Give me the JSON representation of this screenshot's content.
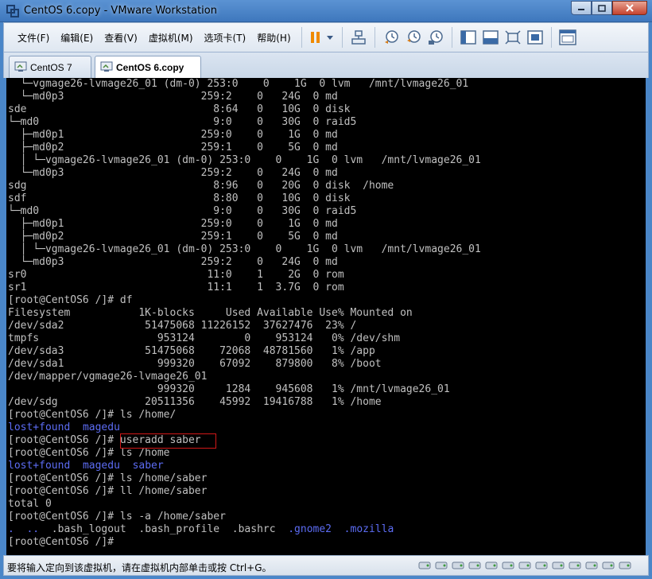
{
  "window": {
    "title": "CentOS 6.copy - VMware Workstation"
  },
  "menu": [
    {
      "label": "文件(F)"
    },
    {
      "label": "编辑(E)"
    },
    {
      "label": "查看(V)"
    },
    {
      "label": "虚拟机(M)"
    },
    {
      "label": "选项卡(T)"
    },
    {
      "label": "帮助(H)"
    }
  ],
  "tabs": [
    {
      "label": "CentOS 7",
      "active": false
    },
    {
      "label": "CentOS 6.copy",
      "active": true
    }
  ],
  "terminal": {
    "lines": [
      [
        {
          "t": "  └─vgmage26-lvmage26_01 (dm-0) 253:0    0    1G  0 lvm   /mnt/lvmage26_01"
        }
      ],
      [
        {
          "t": "  └─md0p3                      259:2    0   24G  0 md"
        }
      ],
      [
        {
          "t": "sde                              8:64   0   10G  0 disk"
        }
      ],
      [
        {
          "t": "└─md0                            9:0    0   30G  0 raid5"
        }
      ],
      [
        {
          "t": "  ├─md0p1                      259:0    0    1G  0 md"
        }
      ],
      [
        {
          "t": "  ├─md0p2                      259:1    0    5G  0 md"
        }
      ],
      [
        {
          "t": "  │ └─vgmage26-lvmage26_01 (dm-0) 253:0    0    1G  0 lvm   /mnt/lvmage26_01"
        }
      ],
      [
        {
          "t": "  └─md0p3                      259:2    0   24G  0 md"
        }
      ],
      [
        {
          "t": "sdg                              8:96   0   20G  0 disk  /home"
        }
      ],
      [
        {
          "t": "sdf                              8:80   0   10G  0 disk"
        }
      ],
      [
        {
          "t": "└─md0                            9:0    0   30G  0 raid5"
        }
      ],
      [
        {
          "t": "  ├─md0p1                      259:0    0    1G  0 md"
        }
      ],
      [
        {
          "t": "  ├─md0p2                      259:1    0    5G  0 md"
        }
      ],
      [
        {
          "t": "  │ └─vgmage26-lvmage26_01 (dm-0) 253:0    0    1G  0 lvm   /mnt/lvmage26_01"
        }
      ],
      [
        {
          "t": "  └─md0p3                      259:2    0   24G  0 md"
        }
      ],
      [
        {
          "t": "sr0                             11:0    1    2G  0 rom"
        }
      ],
      [
        {
          "t": "sr1                             11:1    1  3.7G  0 rom"
        }
      ],
      [
        {
          "t": "[root@CentOS6 /]# df"
        }
      ],
      [
        {
          "t": "Filesystem           1K-blocks     Used Available Use% Mounted on"
        }
      ],
      [
        {
          "t": "/dev/sda2             51475068 11226152  37627476  23% /"
        }
      ],
      [
        {
          "t": "tmpfs                   953124        0    953124   0% /dev/shm"
        }
      ],
      [
        {
          "t": "/dev/sda3             51475068    72068  48781560   1% /app"
        }
      ],
      [
        {
          "t": "/dev/sda1               999320    67092    879800   8% /boot"
        }
      ],
      [
        {
          "t": "/dev/mapper/vgmage26-lvmage26_01"
        }
      ],
      [
        {
          "t": "                        999320     1284    945608   1% /mnt/lvmage26_01"
        }
      ],
      [
        {
          "t": "/dev/sdg              20511356    45992  19416788   1% /home"
        }
      ],
      [
        {
          "t": "[root@CentOS6 /]# ls /home/"
        }
      ],
      [
        {
          "t": "lost+found",
          "c": "blue"
        },
        {
          "t": "  "
        },
        {
          "t": "magedu",
          "c": "blue"
        }
      ],
      [
        {
          "t": "[root@CentOS6 /]# useradd saber"
        }
      ],
      [
        {
          "t": "[root@CentOS6 /]# ls /home"
        }
      ],
      [
        {
          "t": "lost+found",
          "c": "blue"
        },
        {
          "t": "  "
        },
        {
          "t": "magedu",
          "c": "blue"
        },
        {
          "t": "  "
        },
        {
          "t": "saber",
          "c": "blue"
        }
      ],
      [
        {
          "t": "[root@CentOS6 /]# ls /home/saber"
        }
      ],
      [
        {
          "t": "[root@CentOS6 /]# ll /home/saber"
        }
      ],
      [
        {
          "t": "total 0"
        }
      ],
      [
        {
          "t": "[root@CentOS6 /]# ls -a /home/saber"
        }
      ],
      [
        {
          "t": ".",
          "c": "blue"
        },
        {
          "t": "  "
        },
        {
          "t": "..",
          "c": "blue"
        },
        {
          "t": "  .bash_logout  .bash_profile  .bashrc  "
        },
        {
          "t": ".gnome2",
          "c": "blue"
        },
        {
          "t": "  "
        },
        {
          "t": ".mozilla",
          "c": "blue"
        }
      ],
      [
        {
          "t": "[root@CentOS6 /]# "
        }
      ]
    ]
  },
  "status": {
    "text": "要将输入定向到该虚拟机，请在虚拟机内部单击或按 Ctrl+G。"
  },
  "colors": {
    "dir_blue": "#5c6cf3",
    "highlight_red": "#d01818",
    "title_blue": "#3e77bd"
  }
}
